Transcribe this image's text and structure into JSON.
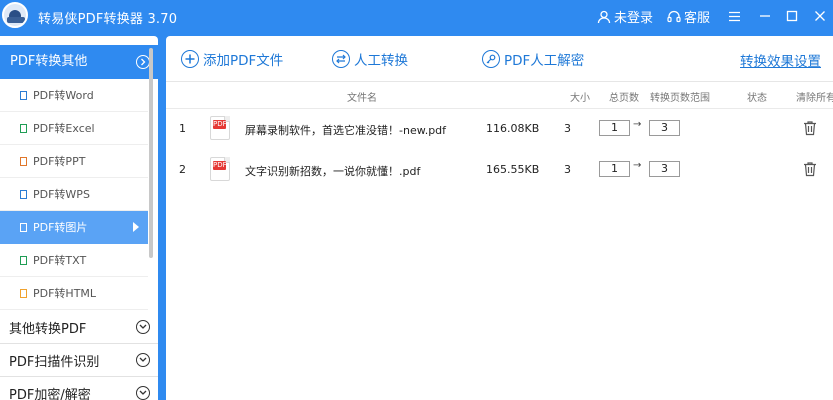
{
  "titlebar": {
    "title": "转易侠PDF转换器 3.70",
    "login_label": "未登录",
    "service_label": "客服"
  },
  "sidebar": {
    "header_label": "PDF转换其他",
    "sub_items": [
      {
        "label": "PDF转Word",
        "icon": "word-file-icon",
        "color": "#2b7cd3"
      },
      {
        "label": "PDF转Excel",
        "icon": "excel-file-icon",
        "color": "#1f9d55"
      },
      {
        "label": "PDF转PPT",
        "icon": "ppt-file-icon",
        "color": "#e0772b"
      },
      {
        "label": "PDF转WPS",
        "icon": "wps-file-icon",
        "color": "#2b7cd3"
      },
      {
        "label": "PDF转图片",
        "icon": "image-file-icon",
        "color": "#ffffff"
      },
      {
        "label": "PDF转TXT",
        "icon": "txt-file-icon",
        "color": "#1f9d55"
      },
      {
        "label": "PDF转HTML",
        "icon": "html-file-icon",
        "color": "#f0a22e"
      }
    ],
    "groups": [
      {
        "label": "其他转换PDF"
      },
      {
        "label": "PDF扫描件识别"
      },
      {
        "label": "PDF加密/解密"
      }
    ]
  },
  "toolbar": {
    "add_file_label": "添加PDF文件",
    "manual_convert_label": "人工转换",
    "decrypt_label": "PDF人工解密",
    "settings_link": "转换效果设置"
  },
  "table": {
    "columns": {
      "filename": "文件名",
      "size": "大小",
      "total_pages": "总页数",
      "page_range": "转换页数范围",
      "status": "状态",
      "clear_all": "清除所有"
    },
    "rows": [
      {
        "index": "1",
        "name": "屏幕录制软件，首选它准没错！-new.pdf",
        "size": "116.08KB",
        "pages": "3",
        "from": "1",
        "to": "3",
        "status": ""
      },
      {
        "index": "2",
        "name": "文字识别新招数，一说你就懂！.pdf",
        "size": "165.55KB",
        "pages": "3",
        "from": "1",
        "to": "3",
        "status": ""
      }
    ],
    "range_arrow": "→",
    "pdf_badge": "PDF"
  },
  "colors": {
    "primary": "#2f8af0",
    "active_item": "#5aa3f5",
    "link": "#1e78d7"
  }
}
